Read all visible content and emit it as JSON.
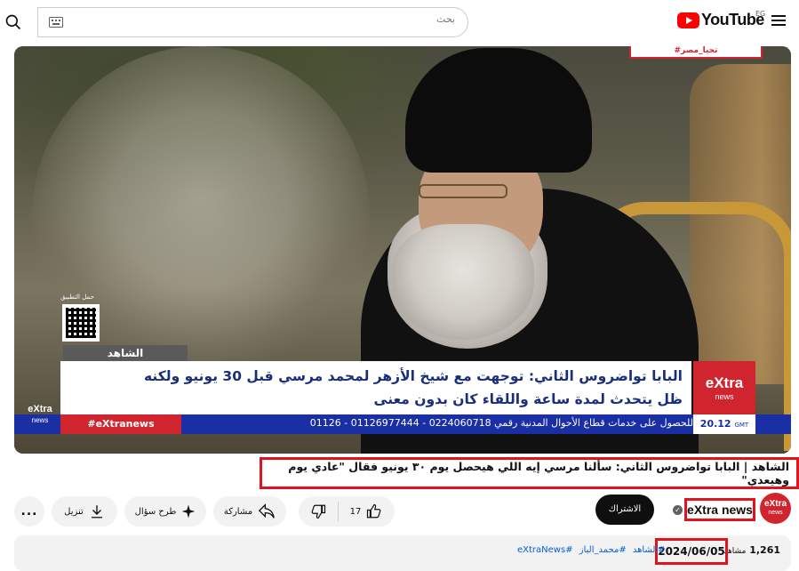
{
  "header": {
    "search_placeholder": "بحث",
    "logo_text": "YouTube",
    "country_code": "EG",
    "icons": {
      "search": "search-icon",
      "keyboard": "keyboard-icon",
      "menu": "menu-icon"
    }
  },
  "video": {
    "top_tag": "#تحيا_مصر",
    "qr_label": "حمل التطبيق",
    "shahed_tag": "الشاهد",
    "headline_line1": "البابا تواضروس الثاني: توجهت مع شيخ الأزهر لمحمد مرسي قبل 30 يونيو ولكنه",
    "headline_line2": "ظل يتحدث لمدة ساعة واللقاء كان بدون معنى",
    "channel_logo": "eXtra",
    "channel_logo_sub": "news",
    "ticker_text": "للحصول على خدمات قطاع الأحوال المدنية رقمي        0224060718 - 01126977444 - 01126",
    "hashtag": "#eXtranews",
    "clock_time": "20.12",
    "clock_zone": "GMT"
  },
  "title": "الشاهد | البابا تواضروس الثاني: سألنا مرسي إيه اللي هيحصل يوم ٣٠ يونيو فقال \"عادي يوم وهيعدي\"",
  "channel": {
    "name": "eXtra news",
    "avatar_text": "eXtra",
    "avatar_sub": "news",
    "subscribe_label": "الاشتراك"
  },
  "actions": {
    "like_count": "17",
    "share_label": "مشاركة",
    "ask_label": "طرح سؤال",
    "download_label": "تنزيل",
    "more_label": "..."
  },
  "description": {
    "views": "1,261",
    "views_label": "مشاهد",
    "date": "2024/06/05",
    "tags": [
      "#الشاهد",
      "#محمد_الباز",
      "#eXtraNews"
    ]
  }
}
